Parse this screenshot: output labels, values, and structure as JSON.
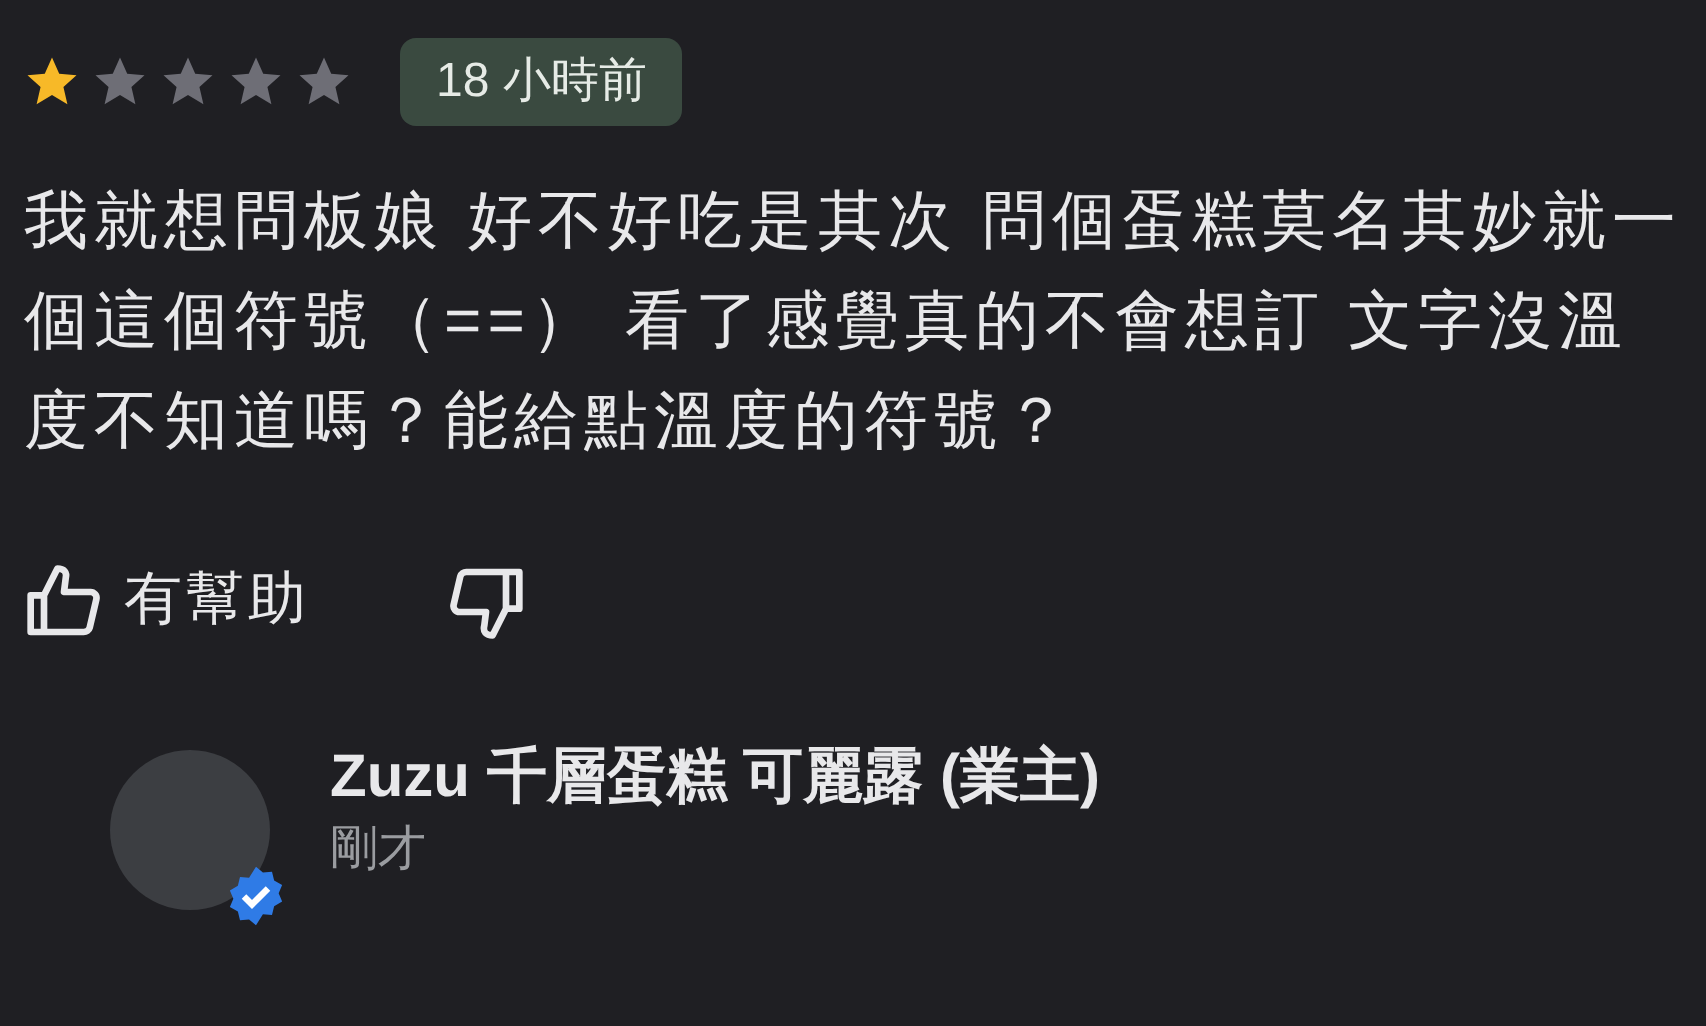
{
  "review": {
    "stars": 1,
    "time": "18 小時前",
    "text": "我就想問板娘 好不好吃是其次 問個蛋糕莫名其妙就一個這個符號（==） 看了感覺真的不會想訂 文字沒溫度不知道嗎？能給點溫度的符號？",
    "helpful_label": "有幫助"
  },
  "reply": {
    "author": "Zuzu 千層蛋糕 可麗露 (業主)",
    "verified": true,
    "time": "剛才"
  }
}
